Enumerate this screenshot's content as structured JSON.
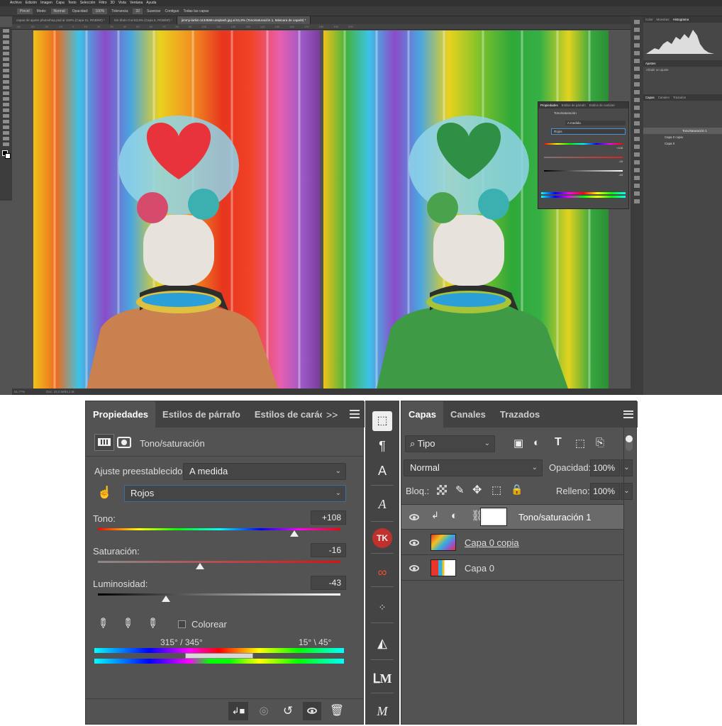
{
  "ps": {
    "menu": [
      "Archivo",
      "Edición",
      "Imagen",
      "Capa",
      "Texto",
      "Selección",
      "Filtro",
      "3D",
      "Vista",
      "Ventana",
      "Ayuda"
    ],
    "options": {
      "preset": "Pincel",
      "mode_label": "Modo:",
      "mode": "Normal",
      "opacity_label": "Opacidad:",
      "opacity": "100%",
      "tolerance_label": "Tolerancia:",
      "tolerance": "32",
      "smooth": "Suavizar",
      "contiguous": "Contiguo",
      "all_layers": "Todas las capas"
    },
    "tabs": [
      "capas de ajuste photoshop.psd al 150% (Capa 11, RGB/8#) *",
      "Sin título-3 al 63,9% (Capa 6, RGB/8#) *",
      "jimmy-larkin-1134558-unsplash.jpg al 51,8% (Tono/saturación 1, Máscara de capa/8) *"
    ],
    "ruler": [
      "-40",
      "-30",
      "-20",
      "-10",
      "0",
      "10",
      "20",
      "30",
      "40",
      "50",
      "60",
      "70",
      "80",
      "90",
      "100",
      "110",
      "120",
      "130",
      "140",
      "150",
      "160",
      "170",
      "180",
      "190",
      "200"
    ],
    "status": {
      "zoom": "51,77%",
      "doc": "Doc: 42,0 M/83,1 M"
    },
    "right_panels": {
      "tabs1": [
        "Color",
        "Muestras",
        "Histograma"
      ],
      "tabs2": [
        "Ajustes"
      ],
      "ajustes_label": "Añadir un ajuste",
      "tabs3": [
        "Capas",
        "Canales",
        "Trazados"
      ],
      "layers": [
        "Tono/saturación 1",
        "Capa 0 copia",
        "Capa 0"
      ]
    },
    "float": {
      "tabs": [
        "Propiedades",
        "Estilos de párrafo",
        "Estilos de carácter"
      ],
      "title": "Tono/saturación",
      "preset": "A medida",
      "channel": "Rojos",
      "tono": "+108",
      "sat": "-16",
      "lum": "-43"
    }
  },
  "props": {
    "tabs": [
      "Propiedades",
      "Estilos de párrafo",
      "Estilos de carácter"
    ],
    "more": ">>",
    "title": "Tono/saturación",
    "preset_label": "Ajuste preestablecido:",
    "preset_value": "A medida",
    "channel": "Rojos",
    "tono_label": "Tono:",
    "tono_value": "+108",
    "tono_level": 0.81,
    "sat_label": "Saturación:",
    "sat_value": "-16",
    "sat_level": 0.42,
    "lum_label": "Luminosidad:",
    "lum_value": "-43",
    "lum_level": 0.28,
    "colorize_label": "Colorear",
    "range_left": "315° / 345°",
    "range_right": "15° \\ 45°"
  },
  "layers": {
    "tabs": [
      "Capas",
      "Canales",
      "Trazados"
    ],
    "filter": "Tipo",
    "blend": "Normal",
    "opacity_label": "Opacidad:",
    "opacity": "100%",
    "lock_label": "Bloq.:",
    "fill_label": "Relleno:",
    "fill": "100%",
    "items": [
      {
        "name": "Tono/saturación 1"
      },
      {
        "name": "Capa 0 copia"
      },
      {
        "name": "Capa 0"
      }
    ]
  },
  "colors": {
    "accent": "#4a8fd6",
    "panel": "#535353",
    "dark": "#424242"
  }
}
